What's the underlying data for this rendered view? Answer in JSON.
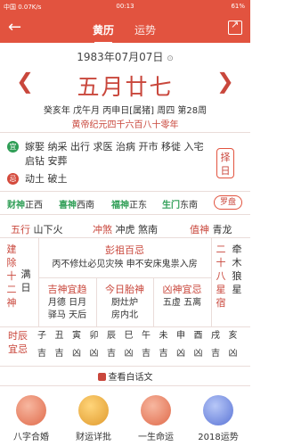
{
  "status": {
    "left": "中国 0.07K/s",
    "time": "00:13",
    "battery": "61%"
  },
  "header": {
    "tab_active": "黄历",
    "tab_other": "运势",
    "back_icon": "arrow-left-icon",
    "share_icon": "share-icon"
  },
  "date": {
    "gregorian": "1983年07月07日",
    "dropdown": "⊙",
    "lunar": "五月廿七",
    "ganzhi": "癸亥年 戊午月 丙申日[属猪] 周四 第28周",
    "huangdi": "黄帝纪元四千六百八十零年"
  },
  "yi": {
    "mark": "宜",
    "text": "嫁娶 纳采 出行 求医 治病 开市 移徙 入宅 启钻 安葬"
  },
  "ji": {
    "mark": "忌",
    "text": "动土 破土"
  },
  "zeri": "择日",
  "gods": {
    "caishen_k": "财神",
    "caishen_v": "正西",
    "xishen_k": "喜神",
    "xishen_v": "西南",
    "fushen_k": "福神",
    "fushen_v": "正东",
    "shengmen_k": "生门",
    "shengmen_v": "东南",
    "luopan": "罗盘"
  },
  "row2": {
    "wuxing_k": "五行",
    "wuxing_v": "山下火",
    "chongsha_k": "冲煞",
    "chongsha_v": "冲虎 煞南",
    "zhishen_k": "值神",
    "zhishen_v": "青龙"
  },
  "jianchu": {
    "label": "建除十二神",
    "value": "满日"
  },
  "pengzu": {
    "title": "彭祖百忌",
    "text": "丙不修灶必见灾殃 申不安床鬼祟入房"
  },
  "jishen": {
    "title": "吉神宜趋",
    "text1": "月德 日月",
    "text2": "驿马 天后"
  },
  "taishen": {
    "title": "今日胎神",
    "text1": "厨灶炉",
    "text2": "房内北"
  },
  "xiongshen": {
    "title": "凶神宜忌",
    "text1": "五虚 五离"
  },
  "xiu": {
    "label": "二十八星宿",
    "value": "牵木狼星"
  },
  "hours": {
    "label": "时辰宜忌",
    "names": [
      "子",
      "丑",
      "寅",
      "卯",
      "辰",
      "巳",
      "午",
      "未",
      "申",
      "酉",
      "戌",
      "亥"
    ],
    "luck": [
      "吉",
      "吉",
      "凶",
      "凶",
      "吉",
      "凶",
      "吉",
      "吉",
      "凶",
      "凶",
      "吉",
      "凶"
    ]
  },
  "detail": "查看白话文",
  "shortcuts": [
    {
      "name": "八字合婚"
    },
    {
      "name": "财运详批"
    },
    {
      "name": "一生命运"
    },
    {
      "name": "2018运势"
    }
  ]
}
